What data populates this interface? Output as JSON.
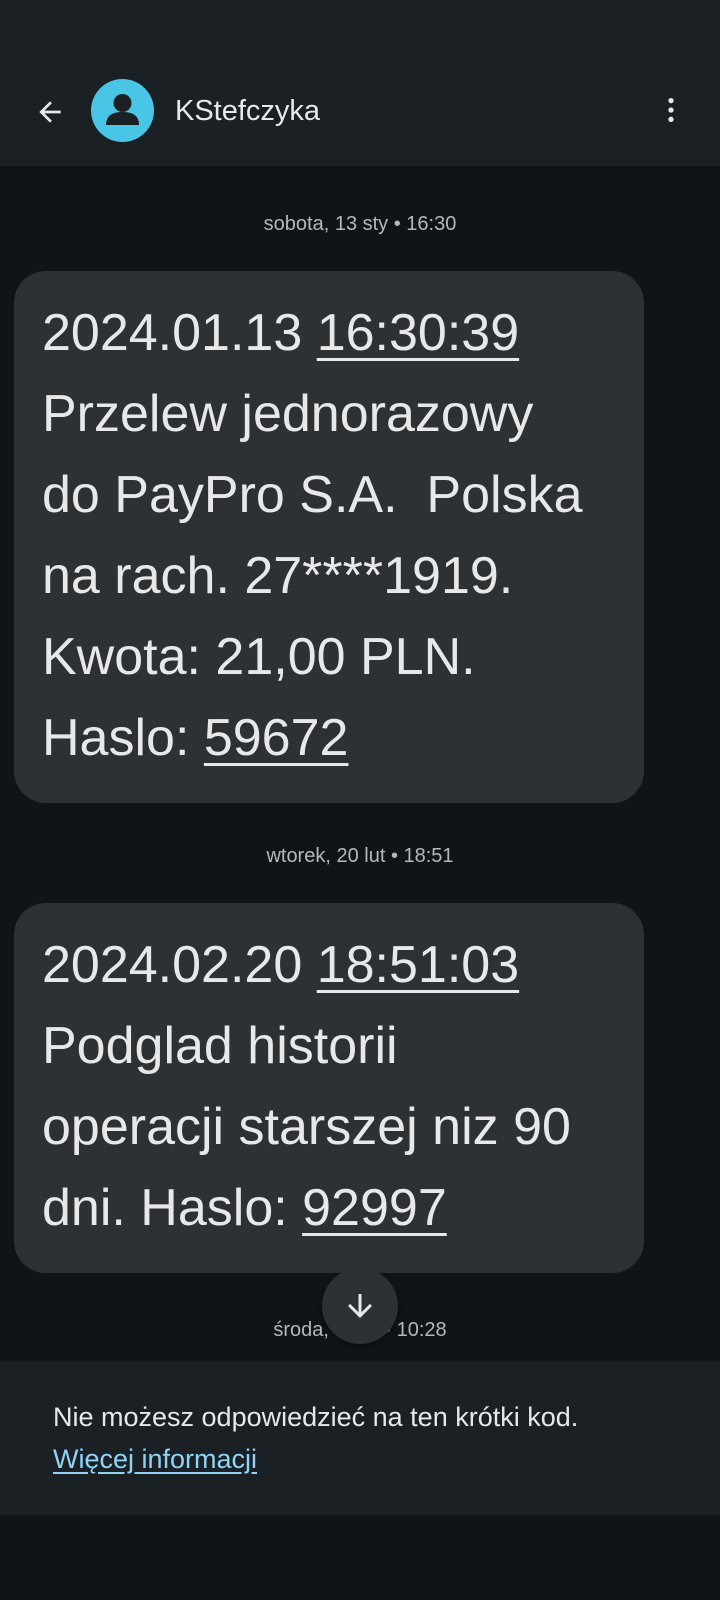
{
  "header": {
    "contact_name": "KStefczyka",
    "avatar_color": "#49c5e6",
    "back_icon": "arrow-back-icon",
    "menu_icon": "more-vert-icon"
  },
  "messages": [
    {
      "date_separator": "sobota, 13 sty • 16:30",
      "date": "2024.01.13",
      "time": "16:30:39",
      "lines": [
        "Przelew jednorazowy",
        "do PayPro S.A.  Polska",
        "na rach. 27****1919.",
        "Kwota: 21,00 PLN."
      ],
      "code_label": "Haslo: ",
      "code": "59672"
    },
    {
      "date_separator": "wtorek, 20 lut • 18:51",
      "date": "2024.02.20",
      "time": "18:51:03",
      "lines": [
        "Podglad historii",
        "operacji starszej niz 90"
      ],
      "code_label": "dni. Haslo: ",
      "code": "92997"
    }
  ],
  "partial_date_separator": {
    "left": "środa, ",
    "right": " • 10:28"
  },
  "scroll_down_icon": "arrow-down-icon",
  "footer": {
    "notice": "Nie możesz odpowiedzieć na ten krótki kod.",
    "link": "Więcej informacji"
  },
  "colors": {
    "background": "#0f1418",
    "bar": "#1b2024",
    "bubble": "#2e3134",
    "text": "#e6e8ea",
    "link": "#8fd3f7"
  }
}
